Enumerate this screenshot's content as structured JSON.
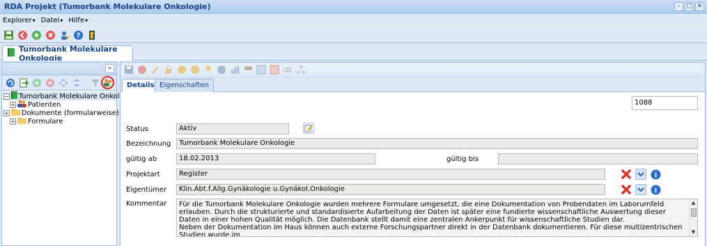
{
  "window": {
    "title": "RDA Projekt (Tumorbank Molekulare Onkologie)",
    "buttons": [
      "–",
      "▢",
      "✕"
    ]
  },
  "menu": [
    "Explorer",
    "Datei",
    "Hilfe"
  ],
  "main_tab": {
    "label": "Tumorbank Molekulare Onkologie"
  },
  "tree": {
    "root": "Tumorbank Molekulare Onkologie",
    "children": [
      "Patienten",
      "Dokumente (formularweise)",
      "Formulare"
    ]
  },
  "detail_tabs": [
    "Details",
    "Eigenschaften"
  ],
  "form": {
    "id_value": "1088",
    "status_label": "Status",
    "status_value": "Aktiv",
    "bezeichnung_label": "Bezeichnung",
    "bezeichnung_value": "Tumorbank Molekulare Onkologie",
    "gueltig_ab_label": "gültig ab",
    "gueltig_ab_value": "18.02.2013",
    "gueltig_bis_label": "gültig bis",
    "gueltig_bis_value": "",
    "projektart_label": "Projektart",
    "projektart_value": "Register",
    "eigentuemer_label": "Eigentümer",
    "eigentuemer_value": "Klin.Abt.f.Allg.Gynäkologie u.Gynäkol.Onkologie",
    "kommentar_label": "Kommentar",
    "kommentar_value": "Für die Tumorbank Molekulare Onkologie wurden mehrere Formulare umgesetzt, die eine Dokumentation von Probendaten im Laborumfeld erlauben. Durch die strukturierte und standardisierte Aufarbeitung der Daten ist später eine fundierte wissenschaftliche Auswertung dieser Daten in einer hohen Qualität möglich. Die Datenbank stellt damit eine zentralen Ankerpunkt für wissenschaftliche Studien dar.\nNeben der Dokumentation im Haus können auch externe Forschungspartner direkt in der Datenbank dokumentieren. Für diese multizentrischen Studien wurde im"
  },
  "colors": {
    "accent": "#15428b",
    "panel_bg": "#dfe8f6",
    "border": "#99bbe8"
  }
}
